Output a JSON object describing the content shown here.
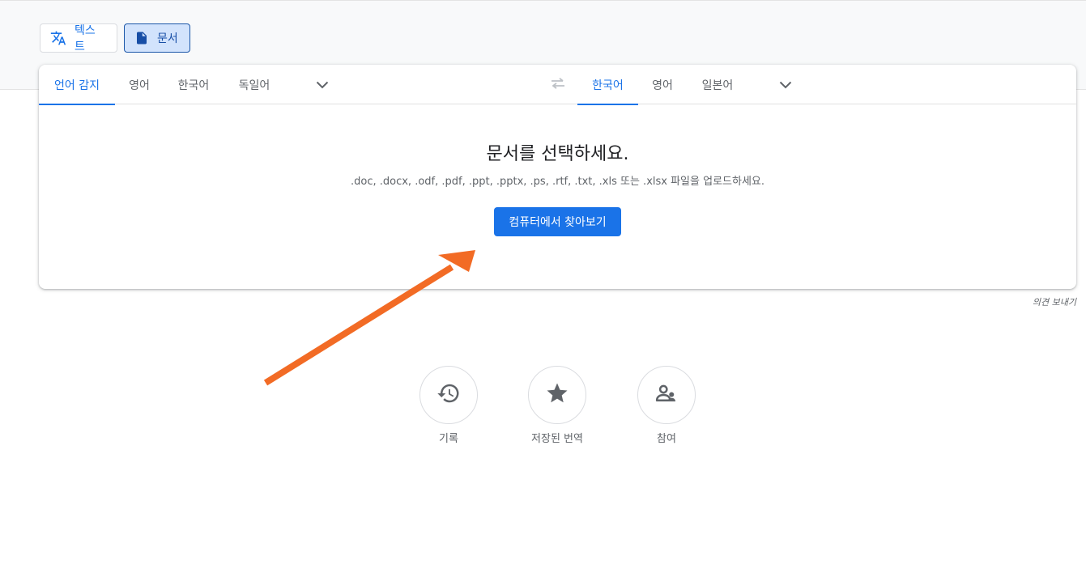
{
  "mode_tabs": {
    "text_label": "텍스트",
    "document_label": "문서"
  },
  "source_langs": [
    "언어 감지",
    "영어",
    "한국어",
    "독일어"
  ],
  "target_langs": [
    "한국어",
    "영어",
    "일본어"
  ],
  "document": {
    "title": "문서를 선택하세요.",
    "subtitle": ".doc, .docx, .odf, .pdf, .ppt, .pptx, .ps, .rtf, .txt, .xls 또는 .xlsx 파일을 업로드하세요.",
    "browse_label": "컴퓨터에서 찾아보기"
  },
  "feedback_label": "의견 보내기",
  "shortcuts": [
    {
      "label": "기록",
      "icon": "history-icon"
    },
    {
      "label": "저장된 번역",
      "icon": "star-icon"
    },
    {
      "label": "참여",
      "icon": "community-icon"
    }
  ],
  "colors": {
    "accent": "#1a73e8",
    "annotation_arrow": "#f26b25"
  }
}
